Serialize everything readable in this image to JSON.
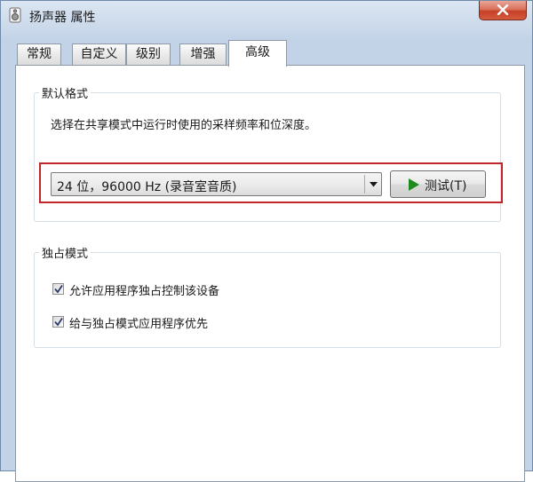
{
  "window": {
    "title": "扬声器 属性",
    "close_label": "close"
  },
  "tabs": [
    {
      "label": "常规",
      "active": false
    },
    {
      "label": "自定义",
      "active": false
    },
    {
      "label": "级别",
      "active": false
    },
    {
      "label": "增强",
      "active": false
    },
    {
      "label": "高级",
      "active": true
    }
  ],
  "default_format": {
    "title": "默认格式",
    "description": "选择在共享模式中运行时使用的采样频率和位深度。",
    "selected_format": "24 位，96000 Hz (录音室音质)",
    "test_button": "测试(T)"
  },
  "exclusive_mode": {
    "title": "独占模式",
    "options": [
      {
        "label": "允许应用程序独占控制该设备",
        "checked": true
      },
      {
        "label": "给与独占模式应用程序优先",
        "checked": true
      }
    ]
  },
  "colors": {
    "highlight": "#c0272d",
    "play_icon": "#1f8a1f",
    "close_button": "#c74028"
  }
}
